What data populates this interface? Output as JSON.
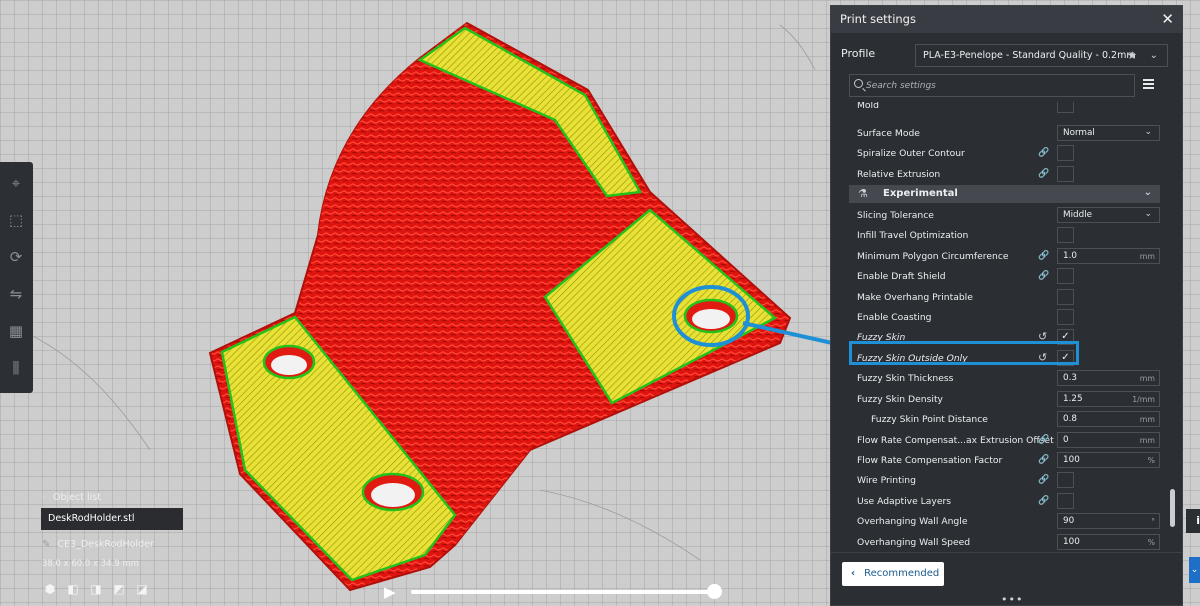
{
  "panel": {
    "title": "Print settings",
    "close_icon": "close-icon",
    "profile_label": "Profile",
    "profile_value": "PLA-E3-Penelope - Standard Quality - 0.2mm",
    "search_placeholder": "Search settings",
    "recommended_label": "Recommended"
  },
  "settings": {
    "mold": "Mold",
    "surface_mode": {
      "label": "Surface Mode",
      "value": "Normal"
    },
    "spiralize": "Spiralize Outer Contour",
    "relative_extrusion": "Relative Extrusion",
    "category_experimental": "Experimental",
    "slicing_tolerance": {
      "label": "Slicing Tolerance",
      "value": "Middle"
    },
    "infill_travel": "Infill Travel Optimization",
    "min_polygon": {
      "label": "Minimum Polygon Circumference",
      "value": "1.0",
      "unit": "mm"
    },
    "draft_shield": "Enable Draft Shield",
    "overhang_printable": "Make Overhang Printable",
    "coasting": "Enable Coasting",
    "fuzzy_skin": {
      "label": "Fuzzy Skin",
      "checked": true
    },
    "fuzzy_outside": {
      "label": "Fuzzy Skin Outside Only",
      "checked": true
    },
    "fuzzy_thickness": {
      "label": "Fuzzy Skin Thickness",
      "value": "0.3",
      "unit": "mm"
    },
    "fuzzy_density": {
      "label": "Fuzzy Skin Density",
      "value": "1.25",
      "unit": "1/mm"
    },
    "fuzzy_point_distance": {
      "label": "Fuzzy Skin Point Distance",
      "value": "0.8",
      "unit": "mm"
    },
    "flow_comp_offset": {
      "label": "Flow Rate Compensat...ax Extrusion Offset",
      "value": "0",
      "unit": "mm"
    },
    "flow_comp_factor": {
      "label": "Flow Rate Compensation Factor",
      "value": "100",
      "unit": "%"
    },
    "wire_printing": "Wire Printing",
    "adaptive_layers": "Use Adaptive Layers",
    "overhang_angle": {
      "label": "Overhanging Wall Angle",
      "value": "90",
      "unit": "°"
    },
    "overhang_speed": {
      "label": "Overhanging Wall Speed",
      "value": "100",
      "unit": "%"
    }
  },
  "objects": {
    "header": "Object list",
    "file": "DeskRodHolder.stl",
    "name": "CE3_DeskRodHolder",
    "dimensions": "38.0 x 60.0 x 34.9 mm"
  },
  "playback": {
    "progress": 1.0
  },
  "colors": {
    "panel_bg": "#2b2e33",
    "highlight": "#1e90d6",
    "model_wall": "#e11b12",
    "model_top": "#e8e033",
    "model_outline": "#22c21a"
  },
  "icons": {
    "left_toolbar": [
      "move-icon",
      "scale-icon",
      "rotate-icon",
      "mirror-icon",
      "per-model-settings-icon",
      "support-blocker-icon"
    ],
    "object_tools": [
      "cube-icon",
      "front-view-icon",
      "top-view-icon",
      "left-view-icon",
      "right-view-icon"
    ],
    "link": "link-icon",
    "reset": "reset-icon",
    "experimental": "flask-icon"
  }
}
